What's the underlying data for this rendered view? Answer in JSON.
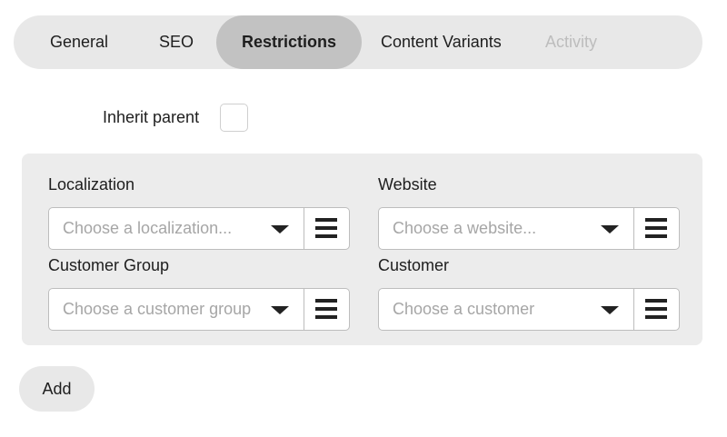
{
  "tabs": [
    {
      "label": "General",
      "state": "normal"
    },
    {
      "label": "SEO",
      "state": "normal"
    },
    {
      "label": "Restrictions",
      "state": "active"
    },
    {
      "label": "Content Variants",
      "state": "normal"
    },
    {
      "label": "Activity",
      "state": "disabled"
    }
  ],
  "inherit": {
    "label": "Inherit parent",
    "checked": false
  },
  "restrictions": {
    "localization": {
      "label": "Localization",
      "placeholder": "Choose a localization..."
    },
    "website": {
      "label": "Website",
      "placeholder": "Choose a website..."
    },
    "customer_group": {
      "label": "Customer Group",
      "placeholder": "Choose a customer group"
    },
    "customer": {
      "label": "Customer",
      "placeholder": "Choose a customer"
    }
  },
  "icons": {
    "dropdown": "caret-down-icon",
    "list": "hamburger-list-icon"
  },
  "add_button": {
    "label": "Add"
  }
}
